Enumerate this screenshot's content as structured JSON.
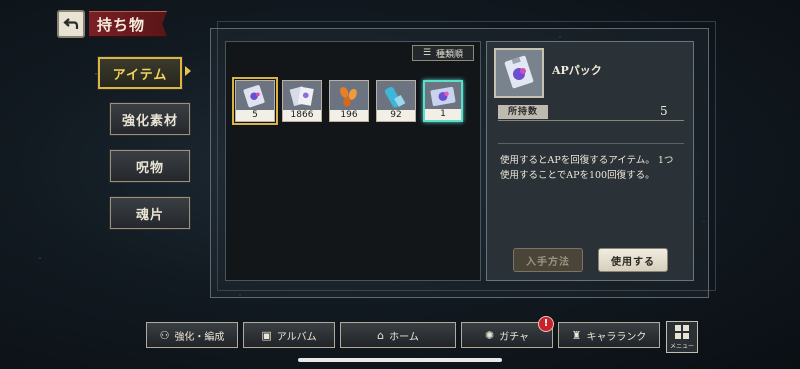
{
  "header": {
    "title": "持ち物"
  },
  "nav": {
    "items": [
      {
        "label": "アイテム",
        "active": true
      },
      {
        "label": "強化素材",
        "active": false
      },
      {
        "label": "呪物",
        "active": false
      },
      {
        "label": "魂片",
        "active": false
      }
    ]
  },
  "sort": {
    "label": "種類順"
  },
  "items": [
    {
      "name": "APパック",
      "count": "5",
      "selected": true
    },
    {
      "name": "cards",
      "count": "1866",
      "selected": false
    },
    {
      "name": "orange-petals",
      "count": "196",
      "selected": false
    },
    {
      "name": "cyan-bottle",
      "count": "92",
      "selected": false
    },
    {
      "name": "rare-pack",
      "count": "1",
      "selected": false
    }
  ],
  "detail": {
    "name": "APパック",
    "quantity_label": "所持数",
    "quantity": "5",
    "description": "使用するとAPを回復するアイテム。 1つ使用することでAPを100回復する。",
    "acquire_label": "入手方法",
    "use_label": "使用する"
  },
  "bottom_nav": {
    "items": [
      {
        "label": "強化・編成",
        "icon": "party-icon"
      },
      {
        "label": "アルバム",
        "icon": "album-icon"
      },
      {
        "label": "ホーム",
        "icon": "home-icon"
      },
      {
        "label": "ガチャ",
        "icon": "gacha-icon"
      },
      {
        "label": "キャラランク",
        "icon": "rank-icon"
      }
    ],
    "badge": "!",
    "menu_label": "メニュー"
  },
  "colors": {
    "accent_gold": "#d9b646",
    "title_red": "#7a2024",
    "rare_cyan": "#59e0c8"
  }
}
